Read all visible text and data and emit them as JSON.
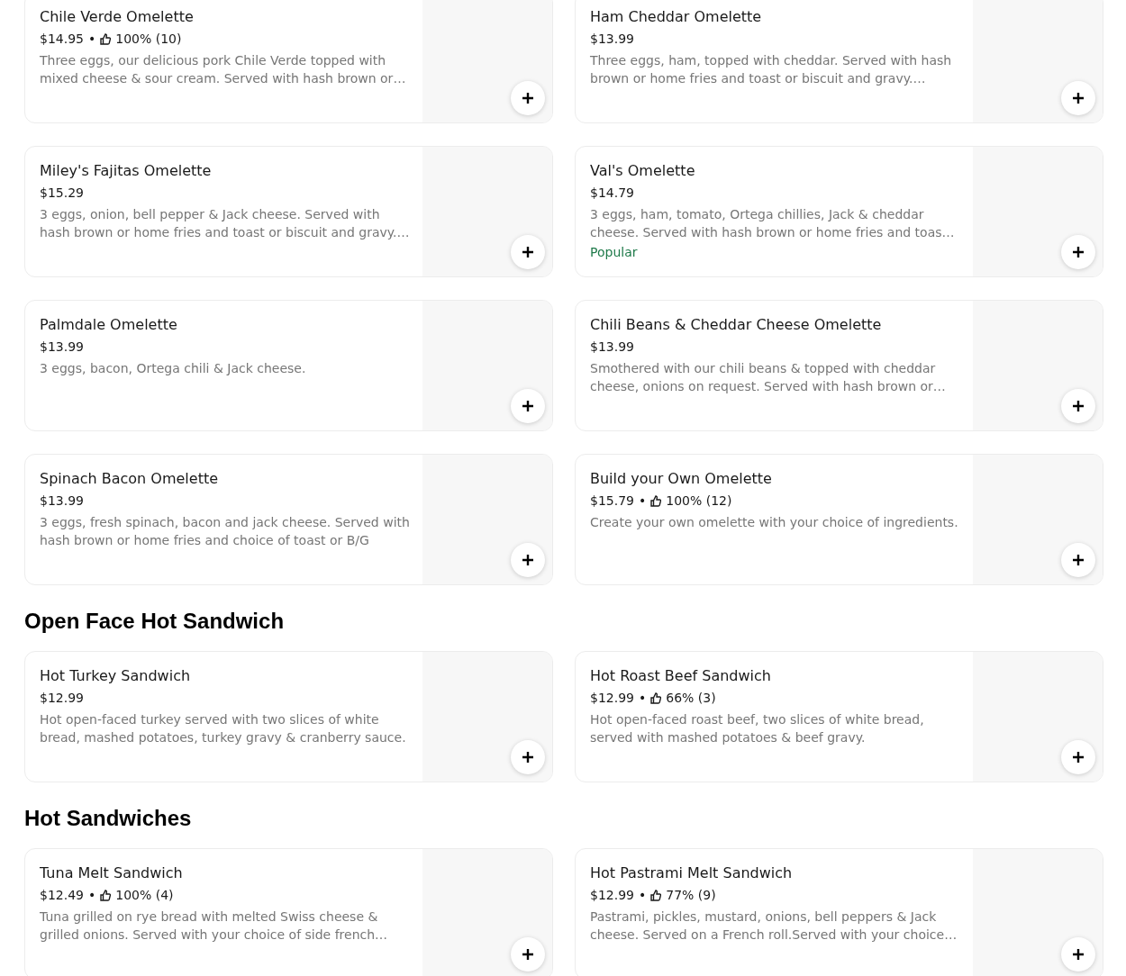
{
  "sections": [
    {
      "items": [
        {
          "name": "Chile Verde Omelette",
          "price": "$14.95",
          "rating": {
            "separator": "•",
            "score": "100% (10)"
          },
          "description": "Three eggs, our delicious pork Chile Verde topped with mixed cheese & sour cream. Served with hash brown or…"
        },
        {
          "name": "Ham Cheddar Omelette",
          "price": "$13.99",
          "description": "Three eggs, ham, topped with cheddar. Served with hash brown or home fries and toast or biscuit and gravy.…"
        },
        {
          "name": "Miley's Fajitas Omelette",
          "price": "$15.29",
          "description": "3 eggs, onion, bell pepper & Jack cheese. Served with hash brown or home fries and toast or biscuit and gravy.…"
        },
        {
          "name": "Val's Omelette",
          "price": "$14.79",
          "description": "3 eggs, ham, tomato, Ortega chillies, Jack & cheddar cheese. Served with hash brown or home fries and toas…",
          "badge": "Popular"
        },
        {
          "name": "Palmdale Omelette",
          "price": "$13.99",
          "description": "3 eggs, bacon, Ortega chili & Jack cheese."
        },
        {
          "name": "Chili Beans & Cheddar Cheese Omelette",
          "price": "$13.99",
          "description": "Smothered with our chili beans & topped with cheddar cheese, onions on request. Served with hash brown or…"
        },
        {
          "name": "Spinach Bacon Omelette",
          "price": "$13.99",
          "description": "3 eggs, fresh spinach, bacon and jack cheese. Served with hash brown or home fries and choice of toast or B/G"
        },
        {
          "name": "Build your Own Omelette",
          "price": "$15.79",
          "rating": {
            "separator": "•",
            "score": "100% (12)"
          },
          "description": "Create your own omelette with your choice of ingredients."
        }
      ]
    },
    {
      "title": "Open Face Hot Sandwich",
      "items": [
        {
          "name": "Hot Turkey Sandwich",
          "price": "$12.99",
          "description": "Hot open-faced turkey served with two slices of white bread, mashed potatoes, turkey gravy & cranberry sauce."
        },
        {
          "name": "Hot Roast Beef Sandwich",
          "price": "$12.99",
          "rating": {
            "separator": "•",
            "score": "66% (3)"
          },
          "description": "Hot open-faced roast beef, two slices of white bread, served with mashed potatoes & beef gravy."
        }
      ]
    },
    {
      "title": "Hot Sandwiches",
      "items": [
        {
          "name": "Tuna Melt Sandwich",
          "price": "$12.49",
          "rating": {
            "separator": "•",
            "score": "100% (4)"
          },
          "description": "Tuna grilled on rye bread with melted Swiss cheese & grilled onions. Served with your choice of side french…"
        },
        {
          "name": "Hot Pastrami Melt Sandwich",
          "price": "$12.99",
          "rating": {
            "separator": "•",
            "score": "77% (9)"
          },
          "description": "Pastrami, pickles, mustard, onions, bell peppers & Jack cheese. Served on a French roll.Served with your choice…"
        }
      ]
    }
  ]
}
